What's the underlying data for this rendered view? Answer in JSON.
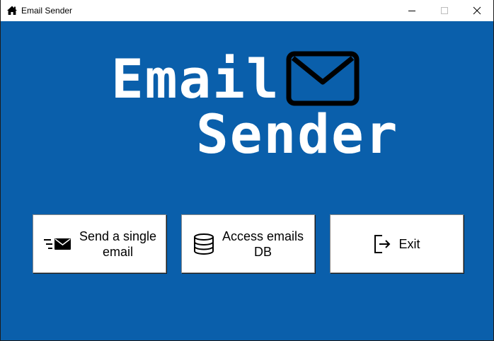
{
  "window": {
    "title": "Email Sender",
    "app_icon": "home-icon",
    "background_color": "#0a5fab"
  },
  "logo": {
    "line1": "Email",
    "line2": "Sender",
    "icon": "envelope-icon"
  },
  "buttons": {
    "send_single": {
      "label_line1": "Send a single",
      "label_line2": "email",
      "icon": "send-mail-icon"
    },
    "access_db": {
      "label_line1": "Access emails",
      "label_line2": "DB",
      "icon": "database-icon"
    },
    "exit": {
      "label": "Exit",
      "icon": "exit-icon"
    }
  }
}
